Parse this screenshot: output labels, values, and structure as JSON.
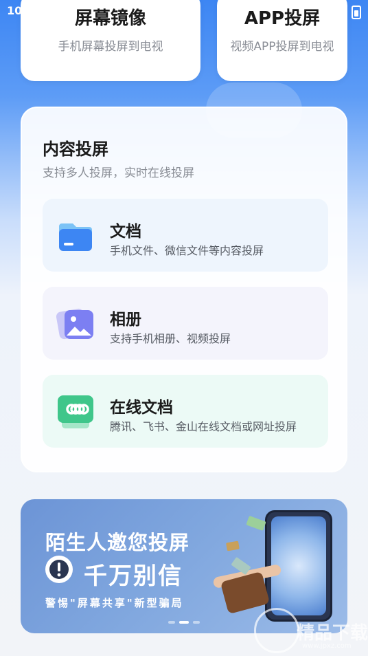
{
  "status_bar": {
    "time": "10"
  },
  "top_cards": [
    {
      "title": "屏幕镜像",
      "subtitle": "手机屏幕投屏到电视"
    },
    {
      "title": "APP投屏",
      "subtitle": "视频APP投屏到电视"
    }
  ],
  "content_section": {
    "title": "内容投屏",
    "subtitle": "支持多人投屏，实时在线投屏",
    "items": [
      {
        "name": "文档",
        "description": "手机文件、微信文件等内容投屏",
        "icon": "folder-icon",
        "color": "#3d86f3"
      },
      {
        "name": "相册",
        "description": "支持手机相册、视频投屏",
        "icon": "photo-album-icon",
        "color": "#7c7ff2"
      },
      {
        "name": "在线文档",
        "description": "腾讯、飞书、金山在线文档或网址投屏",
        "icon": "link-icon",
        "color": "#3fc68a"
      }
    ]
  },
  "banner": {
    "line1": "陌生人邀您投屏",
    "line2": "千万别信",
    "line3": "警惕\"屏幕共享\"新型骗局",
    "warning_icon": "exclamation-icon",
    "page_count": 3,
    "active_page": 2
  },
  "watermark": {
    "text": "精品下载",
    "url": "www.jpxz.com",
    "icon": "p-logo-icon"
  },
  "colors": {
    "accent": "#3d86f3",
    "banner": "#7fa6de"
  }
}
